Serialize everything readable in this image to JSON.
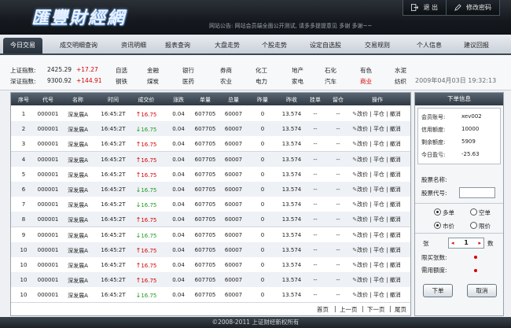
{
  "header": {
    "logo": "匯豐財經網",
    "notice": "网站公告: 网站会员端全面公开测试, 请多多提提意见 多谢 多谢~~",
    "logout": "退 出",
    "change_password": "修改密码"
  },
  "nav": {
    "tabs": [
      "今日交易",
      "成交明细查询",
      "资讯明细",
      "报表查询",
      "大盘走势",
      "个股走势",
      "设定自选股",
      "交易规则",
      "个人信息",
      "建议回报"
    ],
    "active": 0
  },
  "ticker": {
    "sh_label": "上证指数:",
    "sh_value": "2425.29",
    "sh_change": "+17.27",
    "sz_label": "深证指数:",
    "sz_value": "9300.92",
    "sz_change": "+144.91",
    "sectors_row1": [
      "自选",
      "金融",
      "银行",
      "券商",
      "化工",
      "地产",
      "石化",
      "有色",
      "水泥"
    ],
    "sectors_row2": [
      "钢铁",
      "煤炭",
      "医药",
      "农业",
      "电力",
      "家电",
      "汽车",
      "商业",
      "纺织"
    ],
    "highlight_sector": "商业",
    "datetime": "2009年04月03日  19:32:13"
  },
  "table": {
    "headers": [
      "序号",
      "代号",
      "名称",
      "时间",
      "成交价",
      "涨跌",
      "单量",
      "总量",
      "昨量",
      "昨收",
      "挂单",
      "留仓",
      "操作"
    ],
    "rows": [
      {
        "no": "1",
        "code": "000001",
        "name": "深发展A",
        "time": "16:45:2T",
        "dir": "up",
        "price": "16.75",
        "chg": "0.04",
        "vol": "607705",
        "total": "60007",
        "prev": "0",
        "close": "13.574",
        "pend": "--",
        "hold": "--"
      },
      {
        "no": "2",
        "code": "000001",
        "name": "深发展A",
        "time": "16:45:2T",
        "dir": "down",
        "price": "16.75",
        "chg": "0.04",
        "vol": "607705",
        "total": "60007",
        "prev": "0",
        "close": "13.574",
        "pend": "--",
        "hold": "--"
      },
      {
        "no": "3",
        "code": "000001",
        "name": "深发展A",
        "time": "16:45:2T",
        "dir": "up",
        "price": "16.75",
        "chg": "0.04",
        "vol": "607705",
        "total": "60007",
        "prev": "0",
        "close": "13.574",
        "pend": "--",
        "hold": "--"
      },
      {
        "no": "4",
        "code": "000001",
        "name": "深发展A",
        "time": "16:45:2T",
        "dir": "up",
        "price": "16.75",
        "chg": "0.04",
        "vol": "607705",
        "total": "60007",
        "prev": "0",
        "close": "13.574",
        "pend": "--",
        "hold": "--"
      },
      {
        "no": "5",
        "code": "000001",
        "name": "深发展A",
        "time": "16:45:2T",
        "dir": "up",
        "price": "16.75",
        "chg": "0.04",
        "vol": "607705",
        "total": "60007",
        "prev": "0",
        "close": "13.574",
        "pend": "--",
        "hold": "--"
      },
      {
        "no": "6",
        "code": "000001",
        "name": "深发展A",
        "time": "16:45:2T",
        "dir": "down",
        "price": "16.75",
        "chg": "0.04",
        "vol": "607705",
        "total": "60007",
        "prev": "0",
        "close": "13.574",
        "pend": "--",
        "hold": "--"
      },
      {
        "no": "7",
        "code": "000001",
        "name": "深发展A",
        "time": "16:45:2T",
        "dir": "down",
        "price": "16.75",
        "chg": "0.04",
        "vol": "607705",
        "total": "60007",
        "prev": "0",
        "close": "13.574",
        "pend": "--",
        "hold": "--"
      },
      {
        "no": "8",
        "code": "000001",
        "name": "深发展A",
        "time": "16:45:2T",
        "dir": "up",
        "price": "16.75",
        "chg": "0.04",
        "vol": "607705",
        "total": "60007",
        "prev": "0",
        "close": "13.574",
        "pend": "--",
        "hold": "--"
      },
      {
        "no": "9",
        "code": "000001",
        "name": "深发展A",
        "time": "16:45:2T",
        "dir": "down",
        "price": "16.75",
        "chg": "0.04",
        "vol": "607705",
        "total": "60007",
        "prev": "0",
        "close": "13.574",
        "pend": "--",
        "hold": "--"
      },
      {
        "no": "10",
        "code": "000001",
        "name": "深发展A",
        "time": "16:45:2T",
        "dir": "up",
        "price": "16.75",
        "chg": "0.04",
        "vol": "607705",
        "total": "60007",
        "prev": "0",
        "close": "13.574",
        "pend": "--",
        "hold": "--"
      },
      {
        "no": "10",
        "code": "000001",
        "name": "深发展A",
        "time": "16:45:2T",
        "dir": "up",
        "price": "16.75",
        "chg": "0.04",
        "vol": "607705",
        "total": "60007",
        "prev": "0",
        "close": "13.574",
        "pend": "--",
        "hold": "--"
      },
      {
        "no": "10",
        "code": "000001",
        "name": "深发展A",
        "time": "16:45:2T",
        "dir": "up",
        "price": "16.75",
        "chg": "0.04",
        "vol": "607705",
        "total": "60007",
        "prev": "0",
        "close": "13.574",
        "pend": "--",
        "hold": "--"
      },
      {
        "no": "10",
        "code": "000001",
        "name": "深发展A",
        "time": "16:45:2T",
        "dir": "down",
        "price": "16.75",
        "chg": "0.04",
        "vol": "607705",
        "total": "60007",
        "prev": "0",
        "close": "13.574",
        "pend": "--",
        "hold": "--"
      }
    ],
    "actions": {
      "edit": "改价",
      "close": "平仓",
      "cancel": "撤消"
    },
    "pager": {
      "first": "首页",
      "prev": "上一页",
      "next": "下一页",
      "last": "尾页"
    }
  },
  "order": {
    "title": "下单信息",
    "account_label": "会员账号:",
    "account_value": "xev002",
    "credit_label": "信用额度:",
    "credit_value": "10000",
    "remain_label": "剩余额度:",
    "remain_value": "5909",
    "profit_label": "今日盈亏:",
    "profit_value": "-25.63",
    "stock_name_label": "股票名称:",
    "stock_code_label": "股票代号:",
    "buy_label": "多单",
    "sell_label": "空单",
    "market_label": "市价",
    "limit_label": "限价",
    "qty_label": "张",
    "qty_value": "1",
    "qty_unit": "数",
    "limit_qty_label": "限买张数:",
    "margin_label": "需用额度:",
    "submit": "下单",
    "cancel": "取消"
  },
  "footer": {
    "text": "©2008-2011 上证财经新权所有"
  },
  "colors": {
    "up": "#d40000",
    "down": "#1a9b1a",
    "header": "#1a1f24"
  }
}
